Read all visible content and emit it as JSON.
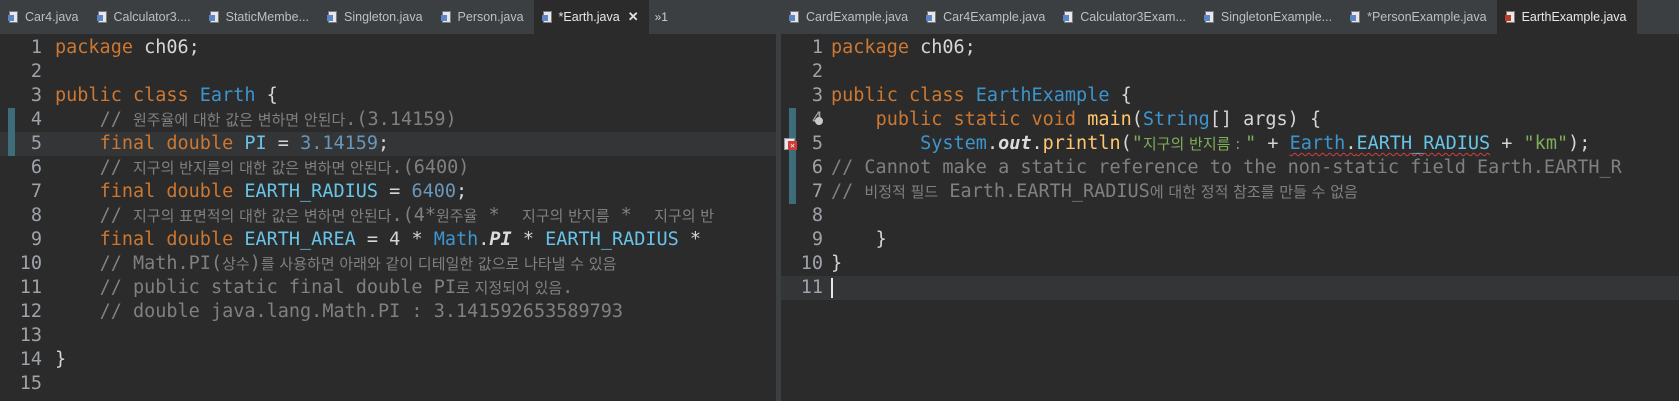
{
  "left_pane": {
    "tabs": [
      {
        "label": "Car4.java",
        "icon": "java-file-icon",
        "active": false
      },
      {
        "label": "Calculator3....",
        "icon": "java-file-icon",
        "active": false
      },
      {
        "label": "StaticMembe...",
        "icon": "java-file-icon",
        "active": false
      },
      {
        "label": "Singleton.java",
        "icon": "java-file-icon",
        "active": false
      },
      {
        "label": "Person.java",
        "icon": "java-file-icon",
        "active": false
      },
      {
        "label": "*Earth.java",
        "icon": "java-file-icon",
        "active": true
      }
    ],
    "overflow_label": "»1",
    "close_glyph": "✕",
    "line_numbers": [
      "1",
      "2",
      "3",
      "4",
      "5",
      "6",
      "7",
      "8",
      "9",
      "10",
      "11",
      "12",
      "13",
      "14",
      "15"
    ],
    "code": {
      "l1_kw": "package",
      "l1_rest": " ch06;",
      "l3_kw": "public class",
      "l3_cls": "Earth",
      "l3_rest": " {",
      "l4_indent": "    ",
      "l4_cmt_a": "// ",
      "l4_cmt_k": "원주율에 대한 값은 변하면 안된다",
      "l4_cmt_b": ".(3.14159)",
      "l5_indent": "    ",
      "l5_kw": "final double",
      "l5_fld": "PI",
      "l5_op": " = ",
      "l5_num": "3.14159",
      "l5_end": ";",
      "l6_indent": "    ",
      "l6_cmt_a": "// ",
      "l6_cmt_k": "지구의 반지름의 대한 값은 변하면 안된다",
      "l6_cmt_b": ".(6400)",
      "l7_indent": "    ",
      "l7_kw": "final double",
      "l7_fld": "EARTH_RADIUS",
      "l7_op": " = ",
      "l7_num": "6400",
      "l7_end": ";",
      "l8_indent": "    ",
      "l8_cmt_a": "// ",
      "l8_cmt_k": "지구의 표면적의 대한 값은 변하면 안된다",
      "l8_cmt_b": ".(4*",
      "l8_cmt_k2": "원주율",
      "l8_cmt_c": " *  ",
      "l8_cmt_k3": "지구의 반지름",
      "l8_cmt_d": " *  ",
      "l8_cmt_k4": "지구의 반",
      "l9_indent": "    ",
      "l9_kw": "final double",
      "l9_fld": "EARTH_AREA",
      "l9_op": " = 4 * ",
      "l9_cls": "Math",
      "l9_dot": ".",
      "l9_it": "PI",
      "l9_op2": " * ",
      "l9_fld2": "EARTH_RADIUS",
      "l9_op3": " *",
      "l10_indent": "    ",
      "l10_cmt_a": "// Math.PI(",
      "l10_cmt_k": "상수",
      "l10_cmt_b": ")",
      "l10_cmt_k2": "를 사용하면 아래와 같이 디테일한 값으로 나타낼 수 있음",
      "l11_indent": "    ",
      "l11_cmt_a": "// public static final double PI",
      "l11_cmt_k": "로 지정되어 있음",
      "l11_cmt_b": ".",
      "l12_indent": "    ",
      "l12_cmt": "// double java.lang.Math.PI : 3.141592653589793",
      "l14": "}"
    }
  },
  "right_pane": {
    "tabs": [
      {
        "label": "CardExample.java",
        "icon": "java-file-icon",
        "active": false
      },
      {
        "label": "Car4Example.java",
        "icon": "java-file-icon",
        "active": false
      },
      {
        "label": "Calculator3Exam...",
        "icon": "java-file-icon",
        "active": false
      },
      {
        "label": "SingletonExample...",
        "icon": "java-file-icon",
        "active": false
      },
      {
        "label": "*PersonExample.java",
        "icon": "java-file-icon",
        "active": false
      },
      {
        "label": "EarthExample.java",
        "icon": "java-file-error-icon",
        "active": true
      }
    ],
    "line_numbers": [
      "1",
      "2",
      "3",
      "4",
      "5",
      "6",
      "7",
      "8",
      "9",
      "10",
      "11"
    ],
    "code": {
      "l1_kw": "package",
      "l1_rest": " ch06;",
      "l3_kw": "public class",
      "l3_cls": "EarthExample",
      "l3_rest": " {",
      "l4_indent": "    ",
      "l4_kw": "public static void",
      "l4_meth": "main",
      "l4_p1": "(",
      "l4_cls": "String",
      "l4_p2": "[] args) {",
      "l5_indent": "        ",
      "l5_cls": "System",
      "l5_dot": ".",
      "l5_it": "out",
      "l5_dot2": ".",
      "l5_meth": "println",
      "l5_p1": "(",
      "l5_str_a": "\"",
      "l5_str_k": "지구의 반지름 : ",
      "l5_str_b": "\"",
      "l5_op": " + ",
      "l5_cls2": "Earth",
      "l5_dot3": ".",
      "l5_fld": "EARTH_RADIUS",
      "l5_op2": " + ",
      "l5_str2": "\"km\"",
      "l5_end": ");",
      "l6_cmt": "// Cannot make a static reference to the non-static field Earth.EARTH_R",
      "l7_cmt_a": "// ",
      "l7_cmt_k": "비정적 필드",
      "l7_cmt_b": " Earth.EARTH_RADIUS",
      "l7_cmt_k2": "에 대한 정적 참조를 만들 수 없음",
      "l9_indent": "    ",
      "l9": "}",
      "l10": "}"
    }
  },
  "colors": {
    "keyword": "#cc7832",
    "class": "#3d95cf",
    "number": "#6897bb",
    "comment": "#808080",
    "string": "#7fae5a",
    "field": "#67c3e8",
    "background": "#2b2b2b"
  }
}
